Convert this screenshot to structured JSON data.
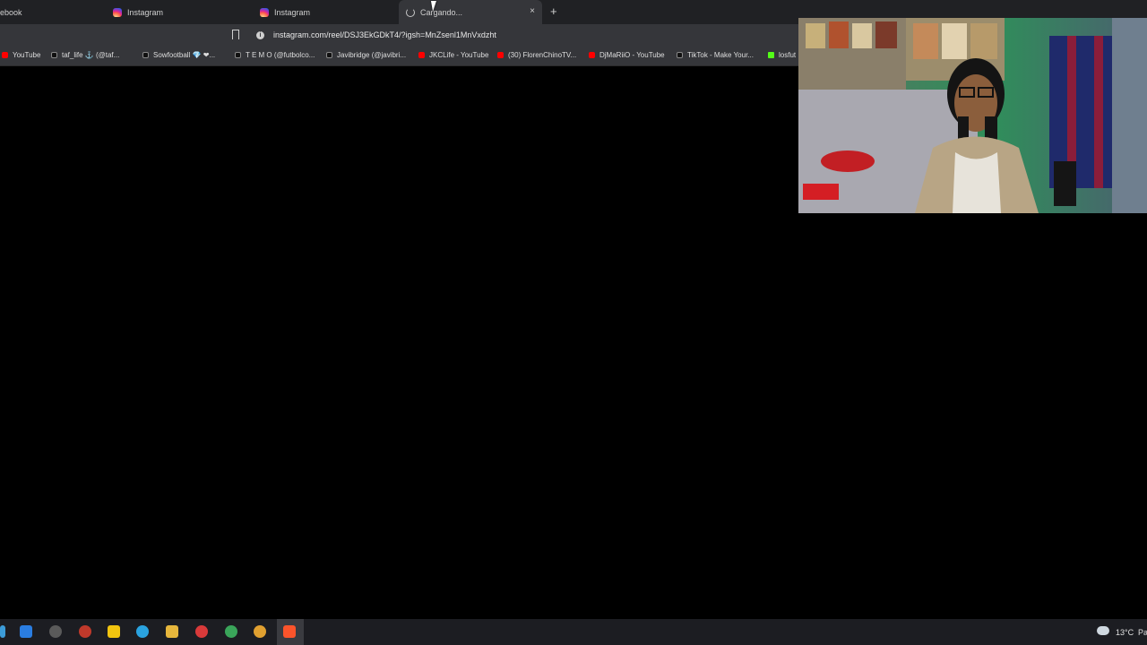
{
  "tabs": [
    {
      "label": "ebook"
    },
    {
      "label": "Instagram"
    },
    {
      "label": "Instagram"
    },
    {
      "label": "Cargando..."
    }
  ],
  "tab_close_glyph": "×",
  "new_tab_glyph": "+",
  "address_bar": {
    "url": "instagram.com/reel/DSJ3EkGDkT4/?igsh=MnZsenl1MnVxdzht"
  },
  "bookmarks": [
    {
      "label": "YouTube",
      "icon": "youtube-icon"
    },
    {
      "label": "taf_life ⚓ (@taf...",
      "icon": "tiktok-icon"
    },
    {
      "label": "Sowfootball 💎 ❤...",
      "icon": "tiktok-icon"
    },
    {
      "label": "T E M O (@futbolco...",
      "icon": "tiktok-icon"
    },
    {
      "label": "Javibridge (@javibri...",
      "icon": "tiktok-icon"
    },
    {
      "label": "JKCLife - YouTube",
      "icon": "youtube-icon"
    },
    {
      "label": "(30) FlorenChinoTV...",
      "icon": "youtube-icon"
    },
    {
      "label": "DjMaRiiO - YouTube",
      "icon": "youtube-icon"
    },
    {
      "label": "TikTok - Make Your...",
      "icon": "tiktok-icon"
    },
    {
      "label": "losfut",
      "icon": "kick-icon"
    }
  ],
  "system_tray": {
    "weather": "13°C",
    "weather_suffix": "Pa"
  },
  "colors": {
    "tab_bar": "#202124",
    "toolbar": "#35363a",
    "page": "#000000",
    "taskbar": "#1c1d22"
  }
}
